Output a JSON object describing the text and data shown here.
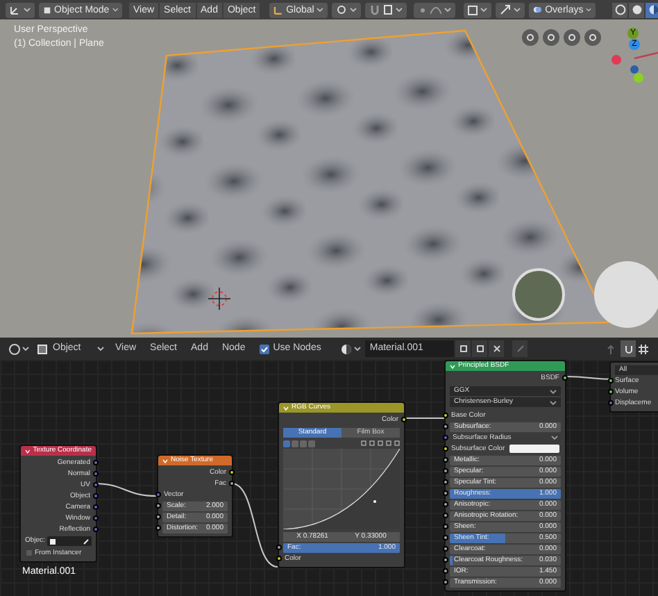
{
  "viewport_header": {
    "mode": "Object Mode",
    "menus": [
      "View",
      "Select",
      "Add",
      "Object"
    ],
    "orientation": "Global",
    "overlays": "Overlays"
  },
  "viewport": {
    "labels": [
      "User Perspective",
      "(1) Collection | Plane"
    ],
    "gizmo_axes": [
      "Y",
      "Z"
    ]
  },
  "node_header": {
    "mode": "Object",
    "menus": [
      "View",
      "Select",
      "Add",
      "Node"
    ],
    "use_nodes": {
      "label": "Use Nodes",
      "checked": true
    },
    "material": "Material.001"
  },
  "nodes": {
    "texture_coordinate": {
      "title": "Texture Coordinate",
      "outputs": [
        "Generated",
        "Normal",
        "UV",
        "Object",
        "Camera",
        "Window",
        "Reflection"
      ],
      "object_label": "Objec:",
      "from_instancer": {
        "label": "From Instancer",
        "checked": false
      }
    },
    "noise_texture": {
      "title": "Noise Texture",
      "outputs": [
        "Color",
        "Fac"
      ],
      "input": "Vector",
      "fields": [
        {
          "label": "Scale:",
          "value": "2.000"
        },
        {
          "label": "Detail:",
          "value": "0.000"
        },
        {
          "label": "Distortion:",
          "value": "0.000"
        }
      ]
    },
    "rgb_curves": {
      "title": "RGB Curves",
      "output": "Color",
      "tabs": [
        {
          "label": "Standard",
          "selected": true
        },
        {
          "label": "Film Box",
          "selected": false
        }
      ],
      "point_x": "X 0.78261",
      "point_y": "Y 0.33000",
      "fac": {
        "label": "Fac:",
        "value": "1.000",
        "level": 1
      },
      "input": "Color"
    },
    "principled_bsdf": {
      "title": "Principled BSDF",
      "output": "BSDF",
      "dropdowns": [
        "GGX",
        "Christensen-Burley"
      ],
      "inputs": [
        {
          "kind": "color_label",
          "label": "Base Color"
        },
        {
          "kind": "value",
          "label": "Subsurface:",
          "value": "0.000",
          "level": 0
        },
        {
          "kind": "vector_dropdown",
          "label": "Subsurface Radius"
        },
        {
          "kind": "color_swatch",
          "label": "Subsurface Color"
        },
        {
          "kind": "value",
          "label": "Metallic:",
          "value": "0.000",
          "level": 0
        },
        {
          "kind": "value",
          "label": "Specular:",
          "value": "0.000",
          "level": 0
        },
        {
          "kind": "value",
          "label": "Specular Tint:",
          "value": "0.000",
          "level": 0
        },
        {
          "kind": "value",
          "label": "Roughness:",
          "value": "1.000",
          "level": 1
        },
        {
          "kind": "value",
          "label": "Anisotropic:",
          "value": "0.000",
          "level": 0
        },
        {
          "kind": "value",
          "label": "Anisotropic Rotation:",
          "value": "0.000",
          "level": 0
        },
        {
          "kind": "value",
          "label": "Sheen:",
          "value": "0.000",
          "level": 0
        },
        {
          "kind": "value",
          "label": "Sheen Tint:",
          "value": "0.500",
          "level": 0.5
        },
        {
          "kind": "value",
          "label": "Clearcoat:",
          "value": "0.000",
          "level": 0
        },
        {
          "kind": "value",
          "label": "Clearcoat Roughness:",
          "value": "0.030",
          "level": 0.03
        },
        {
          "kind": "number",
          "label": "IOR:",
          "value": "1.450"
        },
        {
          "kind": "value",
          "label": "Transmission:",
          "value": "0.000",
          "level": 0
        }
      ]
    },
    "material_output": {
      "target": "All",
      "inputs": [
        "Surface",
        "Volume",
        "Displaceme"
      ]
    }
  },
  "material_label": "Material.001"
}
